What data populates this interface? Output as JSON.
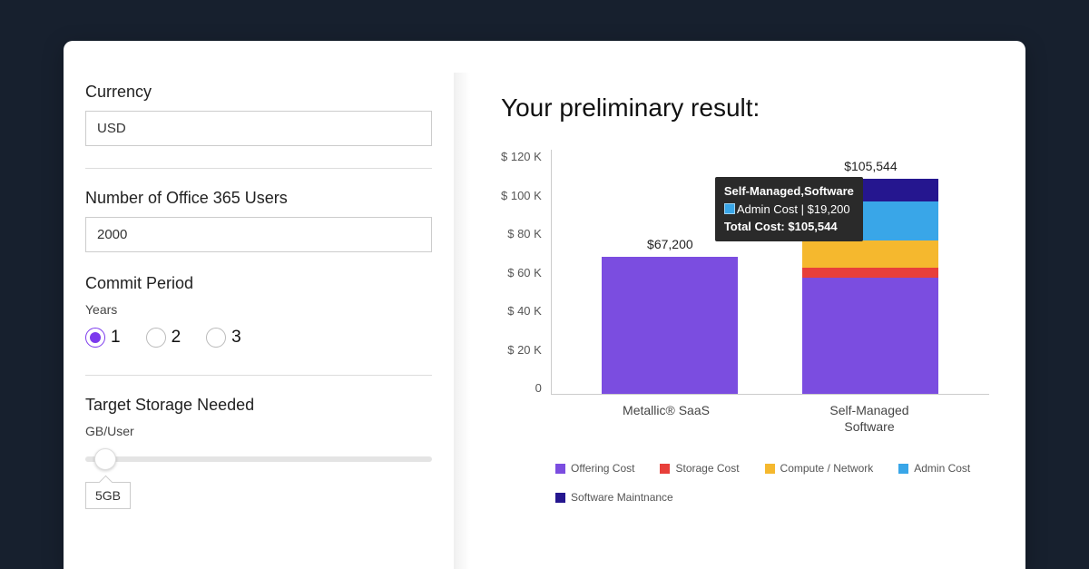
{
  "form": {
    "currency": {
      "label": "Currency",
      "value": "USD"
    },
    "users": {
      "label": "Number of Office 365 Users",
      "value": "2000"
    },
    "commit": {
      "label": "Commit Period",
      "sub": "Years",
      "options": [
        "1",
        "2",
        "3"
      ],
      "selected": 0
    },
    "storage": {
      "label": "Target Storage Needed",
      "sub": "GB/User",
      "value": "5GB"
    }
  },
  "result": {
    "title": "Your preliminary result:",
    "tooltip": {
      "header": "Self-Managed,Software",
      "segment_label": "Admin Cost",
      "segment_value": "$19,200",
      "total_label": "Total Cost:",
      "total_value": "$105,544",
      "swatch_color": "#39a6e8"
    }
  },
  "chart_data": {
    "type": "bar",
    "stacked": true,
    "ylabel": "",
    "ylim": [
      0,
      120000
    ],
    "yticks": [
      "$ 120 K",
      "$ 100 K",
      "$ 80 K",
      "$ 60 K",
      "$ 40 K",
      "$ 20 K",
      "0"
    ],
    "categories": [
      "Metallic® SaaS",
      "Self-Managed Software"
    ],
    "bar_totals": [
      "$67,200",
      "$105,544"
    ],
    "series": [
      {
        "name": "Offering Cost",
        "color": "#7b4de0",
        "values": [
          67200,
          57000
        ]
      },
      {
        "name": "Storage Cost",
        "color": "#e83f3a",
        "values": [
          0,
          5000
        ]
      },
      {
        "name": "Compute / Network",
        "color": "#f5b82e",
        "values": [
          0,
          13000
        ]
      },
      {
        "name": "Admin Cost",
        "color": "#39a6e8",
        "values": [
          0,
          19200
        ]
      },
      {
        "name": "Software Maintnance",
        "color": "#25168f",
        "values": [
          0,
          11344
        ]
      }
    ]
  }
}
